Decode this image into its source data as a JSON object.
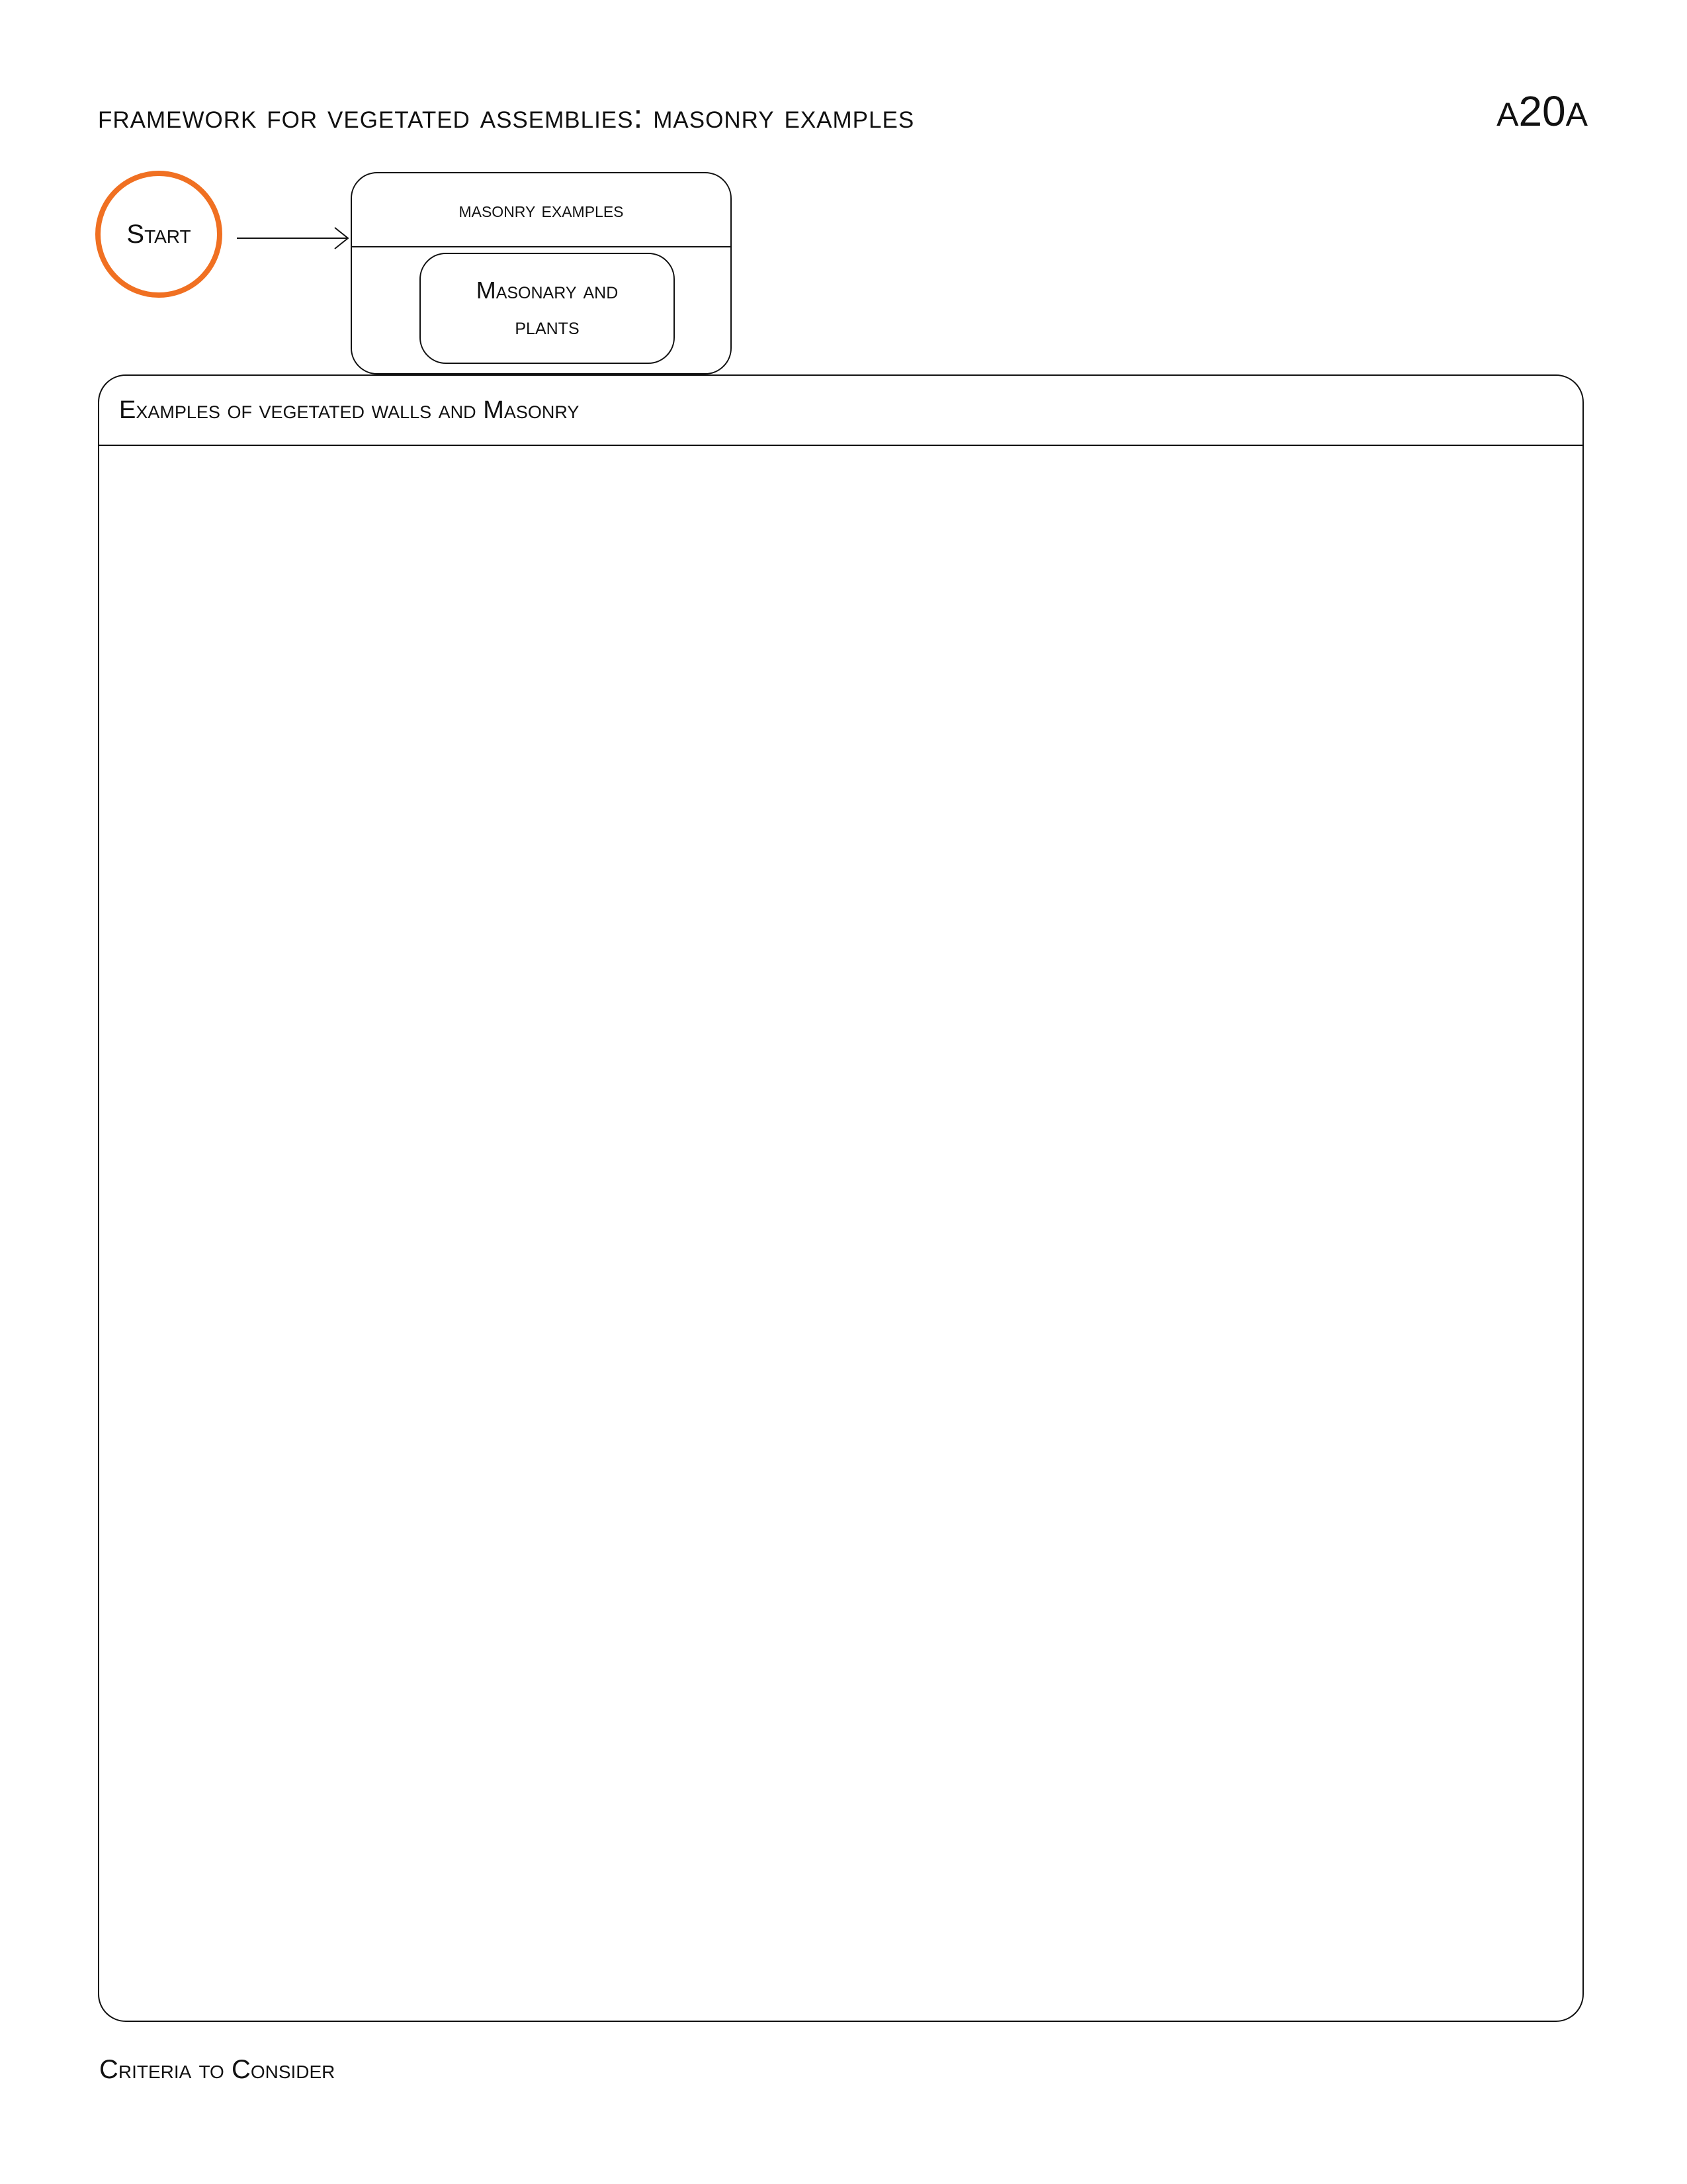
{
  "header": {
    "title": "framework for vegetated assemblies: masonry examples",
    "code_prefix": "A",
    "code_number": "20",
    "code_suffix": "A"
  },
  "diagram": {
    "start_label": "Start",
    "state": {
      "title": "masonry examples",
      "substate_line1": "Masonary and",
      "substate_line2": "plants"
    }
  },
  "examples_panel": {
    "title": "Examples of vegetated walls and Masonry"
  },
  "criteria": {
    "heading": "Criteria to Consider"
  },
  "colors": {
    "start_ring": "#f07022",
    "stroke": "#111111",
    "background": "#ffffff"
  }
}
